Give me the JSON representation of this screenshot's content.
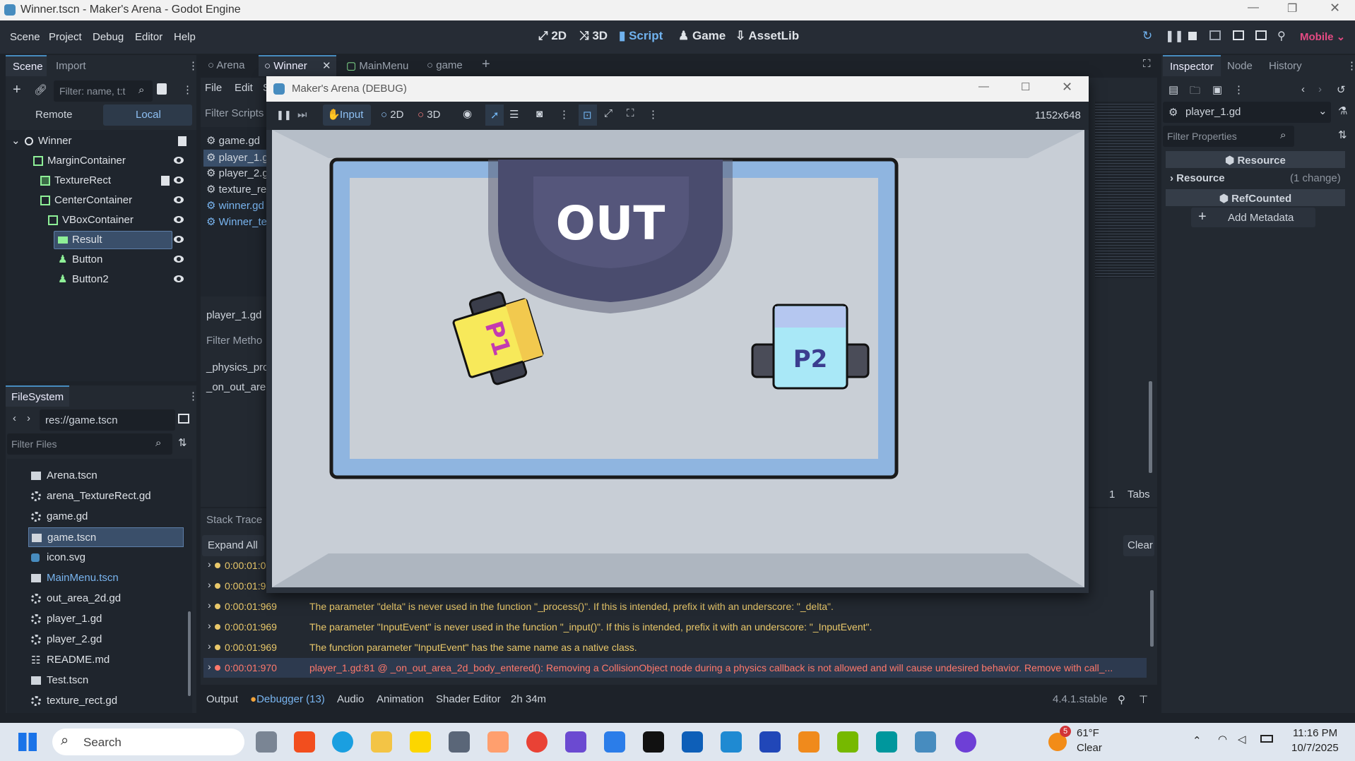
{
  "window": {
    "title": "Winner.tscn - Maker's Arena - Godot Engine"
  },
  "menu": [
    "Scene",
    "Project",
    "Debug",
    "Editor",
    "Help"
  ],
  "workspaces": [
    "2D",
    "3D",
    "Script",
    "Game",
    "AssetLib"
  ],
  "renderer": "Mobile",
  "scene_dock": {
    "tabs": [
      "Scene",
      "Import"
    ],
    "filter_placeholder": "Filter: name, t:t",
    "remote": "Remote",
    "local": "Local",
    "nodes": [
      "Winner",
      "MarginContainer",
      "TextureRect",
      "CenterContainer",
      "VBoxContainer",
      "Result",
      "Button",
      "Button2"
    ]
  },
  "filesystem": {
    "title": "FileSystem",
    "path": "res://game.tscn",
    "filter_placeholder": "Filter Files",
    "files": [
      "Arena.tscn",
      "arena_TextureRect.gd",
      "game.gd",
      "game.tscn",
      "icon.svg",
      "MainMenu.tscn",
      "out_area_2d.gd",
      "player_1.gd",
      "player_2.gd",
      "README.md",
      "Test.tscn",
      "texture_rect.gd"
    ]
  },
  "scene_tabs": [
    "Arena",
    "Winner",
    "MainMenu",
    "game"
  ],
  "script_panel": {
    "menu": [
      "File",
      "Edit",
      "S"
    ],
    "filter_scripts": "Filter Scripts",
    "scripts": [
      "game.gd",
      "player_1.g",
      "player_2.g",
      "texture_re",
      "winner.gd",
      "Winner_te"
    ],
    "current": "player_1.gd",
    "filter_methods": "Filter Metho",
    "methods": [
      "_physics_proc",
      "_on_out_area"
    ]
  },
  "game_window": {
    "title": "Maker's Arena (DEBUG)",
    "toolbar": {
      "input": "Input",
      "2d": "2D",
      "3d": "3D"
    },
    "resolution": "1152x648",
    "out_label": "OUT",
    "p1_label": "P1",
    "p2_label": "P2"
  },
  "debugger": {
    "stack_trace": "Stack Trace",
    "expand_all": "Expand All",
    "clear": "Clear",
    "tabs_count": "1",
    "tabs_label": "Tabs",
    "logs": [
      {
        "time": "0:00:01:0",
        "msg": ""
      },
      {
        "time": "0:00:01:9",
        "msg": ""
      },
      {
        "time": "0:00:01:969",
        "msg": "The parameter \"delta\" is never used in the function \"_process()\". If this is intended, prefix it with an underscore: \"_delta\"."
      },
      {
        "time": "0:00:01:969",
        "msg": "The parameter \"InputEvent\" is never used in the function \"_input()\". If this is intended, prefix it with an underscore: \"_InputEvent\"."
      },
      {
        "time": "0:00:01:969",
        "msg": "The function parameter \"InputEvent\" has the same name as a native class."
      },
      {
        "time": "0:00:01:970",
        "msg": "player_1.gd:81 @ _on_out_area_2d_body_entered(): Removing a CollisionObject node during a physics callback is not allowed and will cause undesired behavior. Remove with call_..."
      }
    ]
  },
  "bottom_tabs": [
    "Output",
    "Debugger (13)",
    "Audio",
    "Animation",
    "Shader Editor",
    "2h 34m"
  ],
  "version": "4.4.1.stable",
  "inspector": {
    "tabs": [
      "Inspector",
      "Node",
      "History"
    ],
    "object": "player_1.gd",
    "filter_placeholder": "Filter Properties",
    "sections": [
      "Resource",
      "Resource",
      "RefCounted"
    ],
    "changes": "(1 change)",
    "add_metadata": "Add Metadata"
  },
  "taskbar": {
    "search": "Search",
    "weather_temp": "61°F",
    "weather_desc": "Clear",
    "weather_badge": "5",
    "time": "11:16 PM",
    "date": "10/7/2025"
  },
  "colors": {
    "accent": "#478cbf",
    "error": "#ff786b",
    "warning": "#e9c86a",
    "game_bg": "#c9cfd6",
    "arena_frame": "#8fb5e0",
    "out_zone": "#4a4c6e",
    "p1": "#f7e95a",
    "p2": "#a9e8f7"
  }
}
